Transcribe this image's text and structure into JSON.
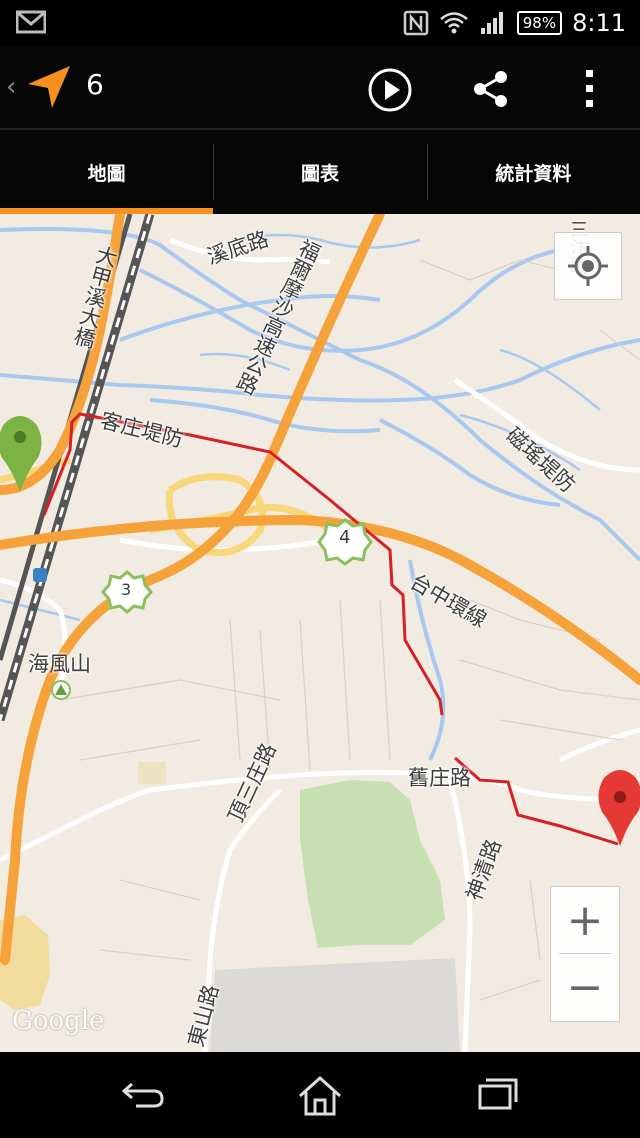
{
  "status_bar": {
    "battery": "98%",
    "time": "8:11"
  },
  "action_bar": {
    "title": "6"
  },
  "tabs": [
    {
      "label": "地圖",
      "active": true
    },
    {
      "label": "圖表",
      "active": false
    },
    {
      "label": "統計資料",
      "active": false
    }
  ],
  "map": {
    "labels": {
      "xidi_road": "溪底路",
      "dajia_bridge": "大甲溪大橋",
      "formosa_freeway": "福爾摩沙高速公路",
      "kezhuang_levee": "客庄堤防",
      "ciyao_levee": "磁瑤堤防",
      "taichung_ring": "台中環線",
      "highway4": "4",
      "highway3": "3",
      "haifeng_mountain": "海風山",
      "jiuzhuang_road": "舊庄路",
      "dingsanzhuang_road": "頂三庄路",
      "shenqing_road": "神清路",
      "dongshan_road": "東山路",
      "top_right_road": "三汴路"
    },
    "attribution": "Google",
    "zoom_in": "+",
    "zoom_out": "−"
  },
  "colors": {
    "accent": "#f6901e",
    "route": "#d71f26",
    "start_marker": "#7cb342",
    "end_marker": "#e53935",
    "highway": "#f6a23b",
    "water": "#a9c8f0"
  },
  "icons": {
    "gmail": "gmail-icon",
    "nfc": "nfc-icon",
    "wifi": "wifi-icon",
    "signal": "signal-icon",
    "app": "navigation-arrow-icon",
    "play": "play-icon",
    "share": "share-icon",
    "more": "more-vert-icon",
    "locate": "my-location-icon",
    "back": "back-icon",
    "home": "home-icon",
    "recents": "recents-icon"
  }
}
